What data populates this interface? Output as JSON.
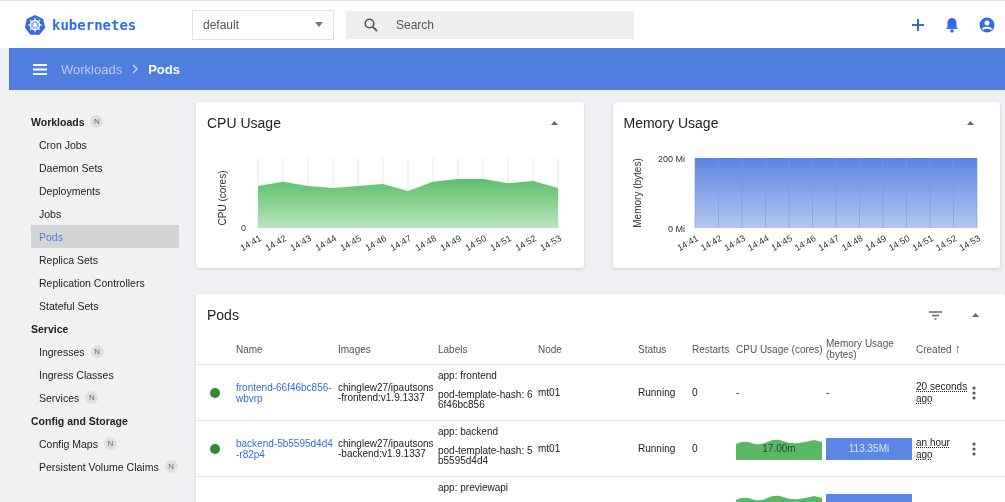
{
  "header": {
    "logo": "kubernetes",
    "namespace": "default",
    "search": {
      "placeholder": "Search"
    }
  },
  "toolbar": {
    "breadcrumbs": [
      {
        "label": "Workloads",
        "current": false
      },
      {
        "label": "Pods",
        "current": true
      }
    ]
  },
  "sidebar": {
    "sections": [
      {
        "title": "Workloads",
        "badge": "N",
        "items": [
          {
            "label": "Cron Jobs",
            "selected": false
          },
          {
            "label": "Daemon Sets",
            "selected": false
          },
          {
            "label": "Deployments",
            "selected": false
          },
          {
            "label": "Jobs",
            "selected": false
          },
          {
            "label": "Pods",
            "selected": true
          },
          {
            "label": "Replica Sets",
            "selected": false
          },
          {
            "label": "Replication Controllers",
            "selected": false
          },
          {
            "label": "Stateful Sets",
            "selected": false
          }
        ]
      },
      {
        "title": "Service",
        "items": [
          {
            "label": "Ingresses",
            "badge": "N",
            "selected": false
          },
          {
            "label": "Ingress Classes",
            "selected": false
          },
          {
            "label": "Services",
            "badge": "N",
            "selected": false
          }
        ]
      },
      {
        "title": "Config and Storage",
        "items": [
          {
            "label": "Config Maps",
            "badge": "N",
            "selected": false
          },
          {
            "label": "Persistent Volume Claims",
            "badge": "N",
            "selected": false
          }
        ]
      }
    ]
  },
  "cpu_card": {
    "title": "CPU Usage",
    "ylabel": "CPU (cores)",
    "yticks": [
      "0"
    ],
    "xlabels": [
      "14:41",
      "14:42",
      "14:43",
      "14:44",
      "14:45",
      "14:46",
      "14:47",
      "14:48",
      "14:49",
      "14:50",
      "14:51",
      "14:52",
      "14:53"
    ]
  },
  "memory_card": {
    "title": "Memory Usage",
    "ylabel": "Memory (bytes)",
    "yticks": [
      "200 Mi",
      "0 Mi"
    ],
    "xlabels": [
      "14:41",
      "14:42",
      "14:43",
      "14:44",
      "14:45",
      "14:46",
      "14:47",
      "14:48",
      "14:49",
      "14:50",
      "14:51",
      "14:52",
      "14:53"
    ]
  },
  "pods": {
    "title": "Pods",
    "columns": [
      {
        "label": "Name"
      },
      {
        "label": "Images"
      },
      {
        "label": "Labels"
      },
      {
        "label": "Node"
      },
      {
        "label": "Status"
      },
      {
        "label": "Restarts"
      },
      {
        "label": "CPU Usage (cores)"
      },
      {
        "label": "Memory Usage (bytes)"
      },
      {
        "label": "Created",
        "sort_icon": "↑"
      }
    ],
    "rows": [
      {
        "color": "#2e8b2e",
        "name": "frontend-66f46bc856-wbvrp",
        "image": "chinglew27/ipautsons-frontend:v1.9.1337",
        "labels": [
          "app: frontend",
          "pod-template-hash: 66f46bc856"
        ],
        "node": "mt01",
        "status": "Running",
        "restarts": "0",
        "cpu": {
          "kind": "text",
          "value": "-"
        },
        "memory": {
          "kind": "text",
          "value": "-"
        },
        "created": "20 seconds ago"
      },
      {
        "color": "#2e8b2e",
        "name": "backend-5b5595d4d4-r82p4",
        "image": "chinglew27/ipautsons-backend:v1.9.1337",
        "labels": [
          "app: backend",
          "pod-template-hash: 5b5595d4d4"
        ],
        "node": "mt01",
        "status": "Running",
        "restarts": "0",
        "cpu": {
          "kind": "graph",
          "value": "17.00m"
        },
        "memory": {
          "kind": "graph",
          "value": "113.35Mi"
        },
        "created": "an hour ago"
      },
      {
        "labels": [
          "app: previewapi"
        ],
        "cpu": {
          "kind": "graph"
        },
        "memory": {
          "kind": "graph"
        }
      }
    ]
  }
}
